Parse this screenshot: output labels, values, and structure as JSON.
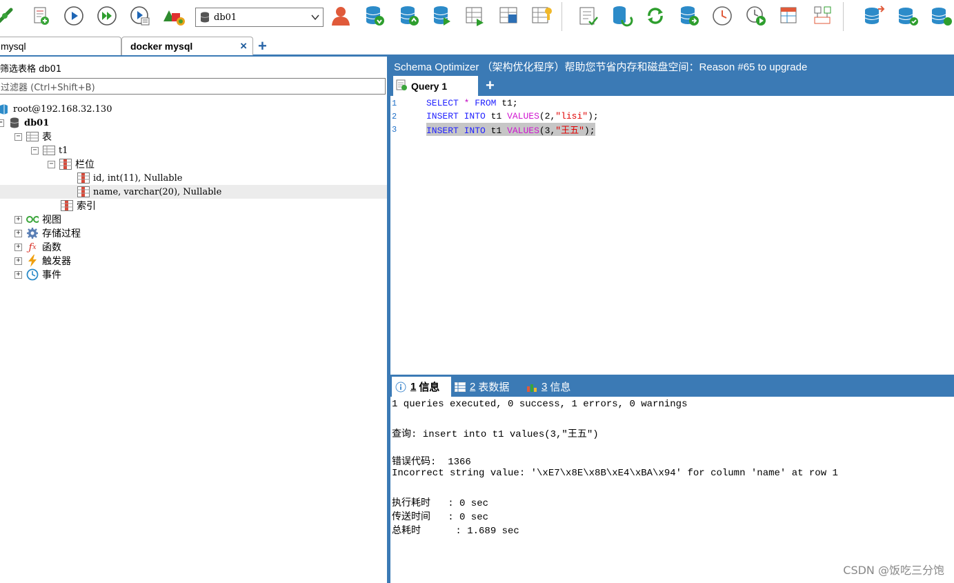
{
  "toolbar": {
    "icons": [
      "connect-icon",
      "new-query-icon",
      "execute-icon",
      "execute-all-icon",
      "execute-current-icon",
      "schema-designer-icon",
      "user-manager-icon",
      "backup-db-icon",
      "restore-db-icon",
      "import-db-icon",
      "schema-sync-icon",
      "data-sync-icon",
      "table-diagnostics-icon",
      "query-builder-icon",
      "sql-import-icon",
      "refresh-icon",
      "database-sync-icon",
      "scheduler-icon",
      "run-job-icon",
      "table-editor-icon",
      "rebuild-index-icon",
      "copy-db-icon",
      "data-compare-icon",
      "data-migrate-icon"
    ],
    "database_select": "db01"
  },
  "connection_tabs": [
    {
      "label": "mysql"
    },
    {
      "label": "docker mysql",
      "close": "×"
    }
  ],
  "new_tab_plus": "+",
  "left_panel": {
    "filter_title": "筛选表格 db01",
    "filter_placeholder": "过滤器 (Ctrl+Shift+B)",
    "tree": {
      "connection": "root@192.168.32.130",
      "database": "db01",
      "tables_folder": "表",
      "table": "t1",
      "columns_folder": "栏位",
      "columns": [
        "id, int(11), Nullable",
        "name, varchar(20), Nullable"
      ],
      "indexes_folder": "索引",
      "views": "视图",
      "procedures": "存储过程",
      "functions": "函数",
      "triggers": "触发器",
      "events": "事件"
    }
  },
  "right_panel": {
    "banner": "Schema Optimizer （架构优化程序）帮助您节省内存和磁盘空间：Reason #65 to upgrade",
    "query_tab": "Query 1",
    "query_plus": "+",
    "editor": {
      "line_numbers": [
        "1",
        "2",
        "3"
      ],
      "line1": {
        "kw1": "SELECT",
        "star": " * ",
        "kw2": "FROM",
        "rest": " t1;"
      },
      "line2": {
        "kw1": "INSERT",
        "kw2": "INTO",
        "tbl": " t1 ",
        "fn": "VALUES",
        "p1": "(2,",
        "str": "\"lisi\"",
        "p2": ");"
      },
      "line3": {
        "kw1": "INSERT",
        "kw2": "INTO",
        "tbl": " t1 ",
        "fn": "VALUES",
        "p1": "(3,",
        "str": "\"王五\"",
        "p2": ");"
      }
    },
    "result_tabs": [
      {
        "num": "1",
        "label": "信息"
      },
      {
        "num": "2",
        "label": "表数据"
      },
      {
        "num": "3",
        "label": "信息"
      }
    ],
    "results": {
      "summary": "1 queries executed, 0 success, 1 errors, 0 warnings",
      "query_line": "查询: insert into t1 values(3,\"王五\")",
      "error_code_line": "错误代码:  1366",
      "error_message": "Incorrect string value: '\\xE7\\x8E\\x8B\\xE4\\xBA\\x94' for column 'name' at row 1",
      "exec_time": "执行耗时   : 0 sec",
      "transfer_time": "传送时间   : 0 sec",
      "total_time": "总耗时      : 1.689 sec"
    },
    "watermark": "CSDN @饭吃三分饱"
  },
  "colors": {
    "accent": "#3b7ab5",
    "keyword": "#2222ff",
    "string": "#e00000",
    "function": "#d014d0"
  }
}
